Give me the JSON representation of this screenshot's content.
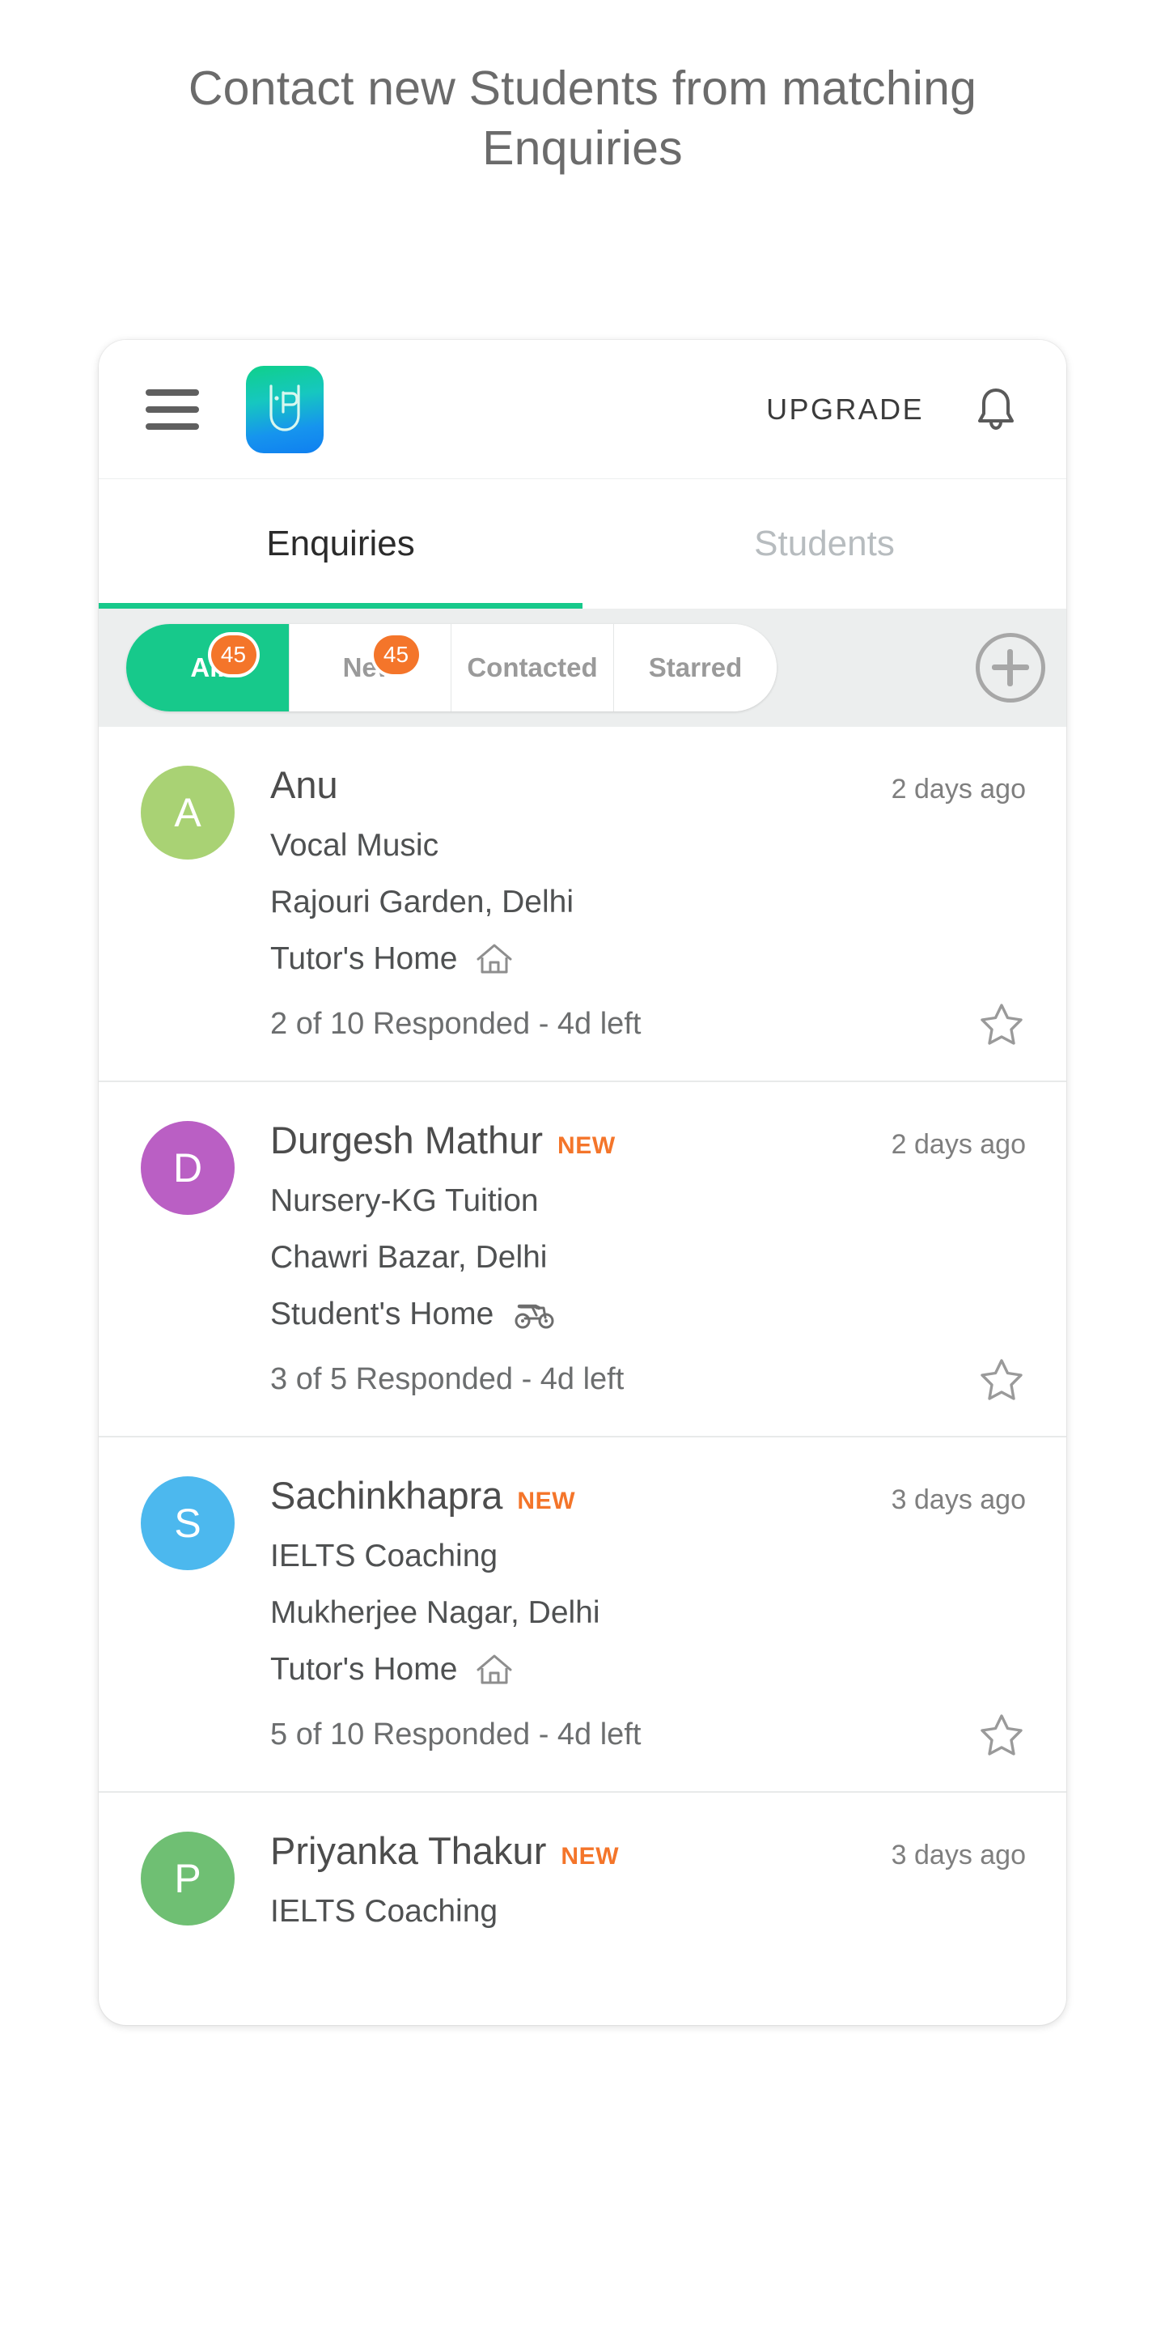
{
  "headline": "Contact new Students from matching Enquiries",
  "appbar": {
    "menu_icon": "hamburger-menu-icon",
    "logo_icon": "urbanpro-logo-icon",
    "upgrade_label": "UPGRADE",
    "bell_icon": "notification-bell-icon"
  },
  "tabs": [
    {
      "label": "Enquiries",
      "active": true
    },
    {
      "label": "Students",
      "active": false
    }
  ],
  "filters": [
    {
      "label": "All",
      "count": "45",
      "active": true
    },
    {
      "label": "New",
      "count": "45",
      "active": false
    },
    {
      "label": "Contacted",
      "count": "",
      "active": false
    },
    {
      "label": "Starred",
      "count": "",
      "active": false
    }
  ],
  "add_button_icon": "plus-circle-icon",
  "colors": {
    "accent_green": "#17c98b",
    "badge_orange": "#f4752a",
    "avatar_anu": "#a9d274",
    "avatar_durgesh": "#ba5fc4",
    "avatar_sachin": "#4cb8ee",
    "avatar_priyanka": "#6fbf73"
  },
  "enquiries": [
    {
      "initial": "A",
      "name": "Anu",
      "is_new": false,
      "new_label": "",
      "time": "2 days ago",
      "subject": "Vocal Music",
      "location": "Rajouri Garden, Delhi",
      "mode": "Tutor's Home",
      "mode_icon": "home-icon",
      "responded": "2 of 10 Responded - 4d left",
      "star_icon": "star-outline-icon"
    },
    {
      "initial": "D",
      "name": "Durgesh Mathur",
      "is_new": true,
      "new_label": "NEW",
      "time": "2 days ago",
      "subject": "Nursery-KG Tuition",
      "location": "Chawri Bazar, Delhi",
      "mode": "Student's Home",
      "mode_icon": "scooter-icon",
      "responded": "3 of 5 Responded - 4d left",
      "star_icon": "star-outline-icon"
    },
    {
      "initial": "S",
      "name": "Sachinkhapra",
      "is_new": true,
      "new_label": "NEW",
      "time": "3 days ago",
      "subject": "IELTS Coaching",
      "location": "Mukherjee  Nagar, Delhi",
      "mode": "Tutor's Home",
      "mode_icon": "home-icon",
      "responded": "5 of 10 Responded - 4d left",
      "star_icon": "star-outline-icon"
    },
    {
      "initial": "P",
      "name": "Priyanka Thakur",
      "is_new": true,
      "new_label": "NEW",
      "time": "3 days ago",
      "subject": "IELTS Coaching",
      "location": "",
      "mode": "",
      "mode_icon": "",
      "responded": "",
      "star_icon": ""
    }
  ]
}
